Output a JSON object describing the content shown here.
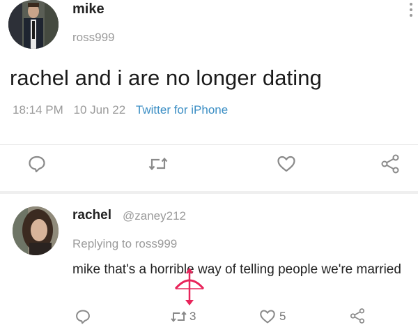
{
  "tweet": {
    "display_name": "mike",
    "handle": "ross999",
    "text": "rachel and i are no longer dating",
    "time": "18:14 PM",
    "date": "10 Jun 22",
    "source": "Twitter for iPhone"
  },
  "reply": {
    "display_name": "rachel",
    "handle": "@zaney212",
    "replying_to": "Replying to ross999",
    "text": "mike that's a horrible way of telling people we're married",
    "retweet_count": "3",
    "like_count": "5"
  },
  "colors": {
    "source_link": "#3b8ec4",
    "muted": "#9a9a9a",
    "watermark": "#e8245a"
  },
  "icons": [
    "reply-icon",
    "retweet-icon",
    "heart-icon",
    "share-icon",
    "more-icon"
  ]
}
